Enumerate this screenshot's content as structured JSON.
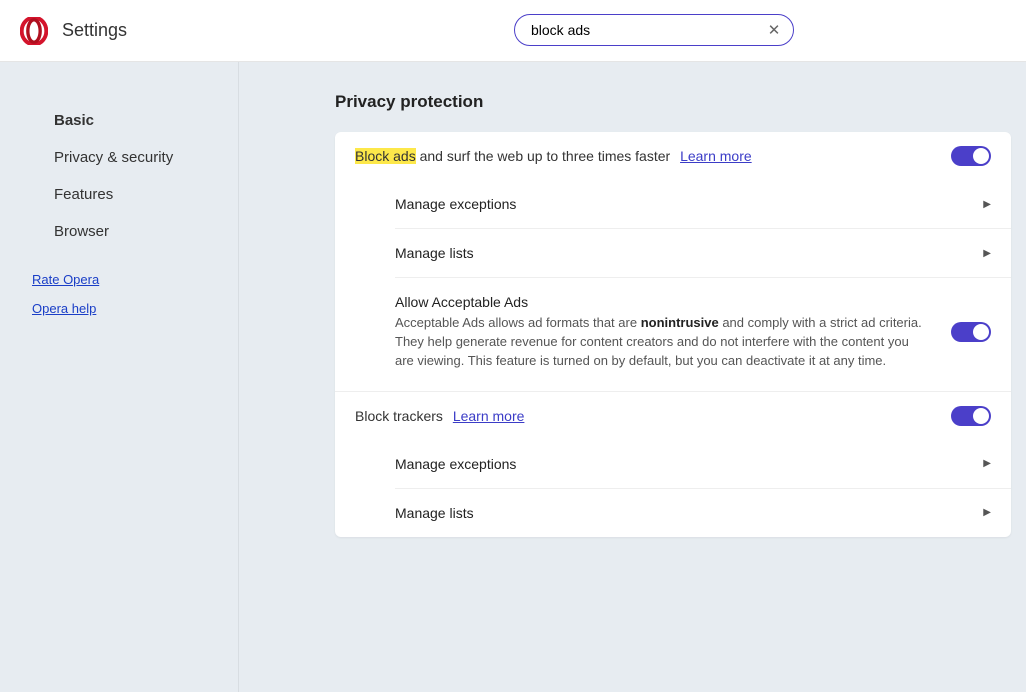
{
  "header": {
    "title": "Settings",
    "search_value": "block ads"
  },
  "sidebar": {
    "nav": [
      {
        "label": "Basic",
        "active": true
      },
      {
        "label": "Privacy & security",
        "active": false
      },
      {
        "label": "Features",
        "active": false
      },
      {
        "label": "Browser",
        "active": false
      }
    ],
    "links": {
      "rate": "Rate Opera",
      "help": "Opera help"
    }
  },
  "main": {
    "section_title": "Privacy protection",
    "block_ads": {
      "highlight": "Block ads",
      "rest": " and surf the web up to three times faster",
      "learn": "Learn more",
      "toggle_on": true,
      "sub": {
        "exceptions": "Manage exceptions",
        "lists": "Manage lists",
        "acceptable_title": "Allow Acceptable Ads",
        "acceptable_desc_pre": "Acceptable Ads allows ad formats that are ",
        "acceptable_desc_bold": "nonintrusive",
        "acceptable_desc_post": " and comply with a strict ad criteria. They help generate revenue for content creators and do not interfere with the content you are viewing. This feature is turned on by default, but you can deactivate it at any time.",
        "acceptable_toggle_on": true
      }
    },
    "block_trackers": {
      "label": "Block trackers",
      "learn": "Learn more",
      "toggle_on": true,
      "sub": {
        "exceptions": "Manage exceptions",
        "lists": "Manage lists"
      }
    }
  }
}
